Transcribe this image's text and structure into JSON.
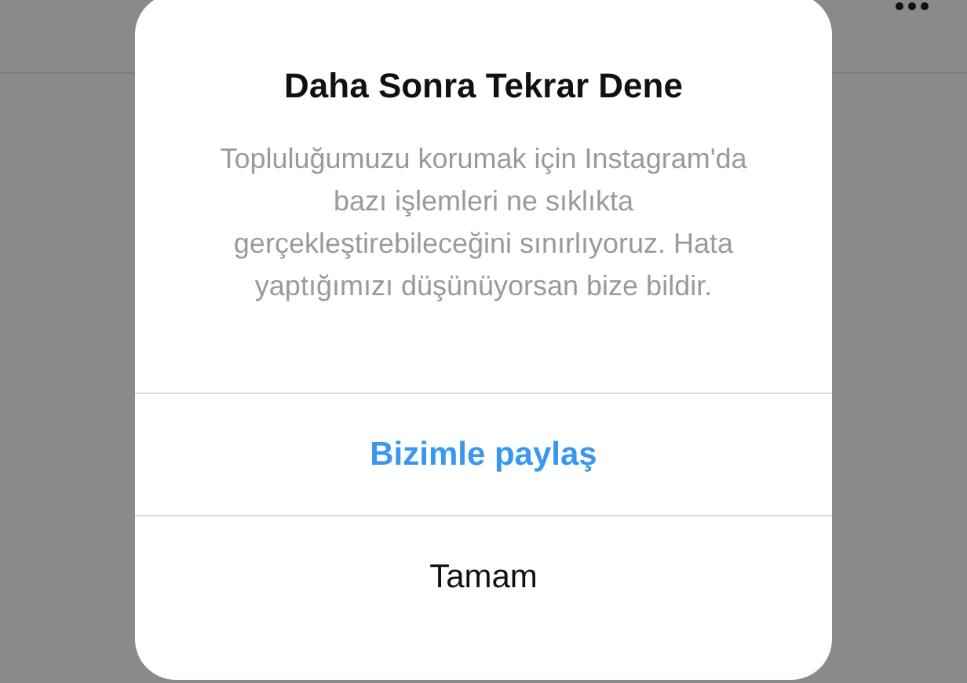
{
  "dialog": {
    "title": "Daha Sonra Tekrar Dene",
    "message": "Topluluğumuzu korumak için Instagram'da bazı işlemleri ne sıklıkta gerçekleştirebileceğini sınırlıyoruz. Hata yaptığımızı düşünüyorsan bize bildir.",
    "buttons": [
      {
        "label": "Bizimle paylaş",
        "kind": "primary"
      },
      {
        "label": "Tamam",
        "kind": "default"
      }
    ]
  }
}
